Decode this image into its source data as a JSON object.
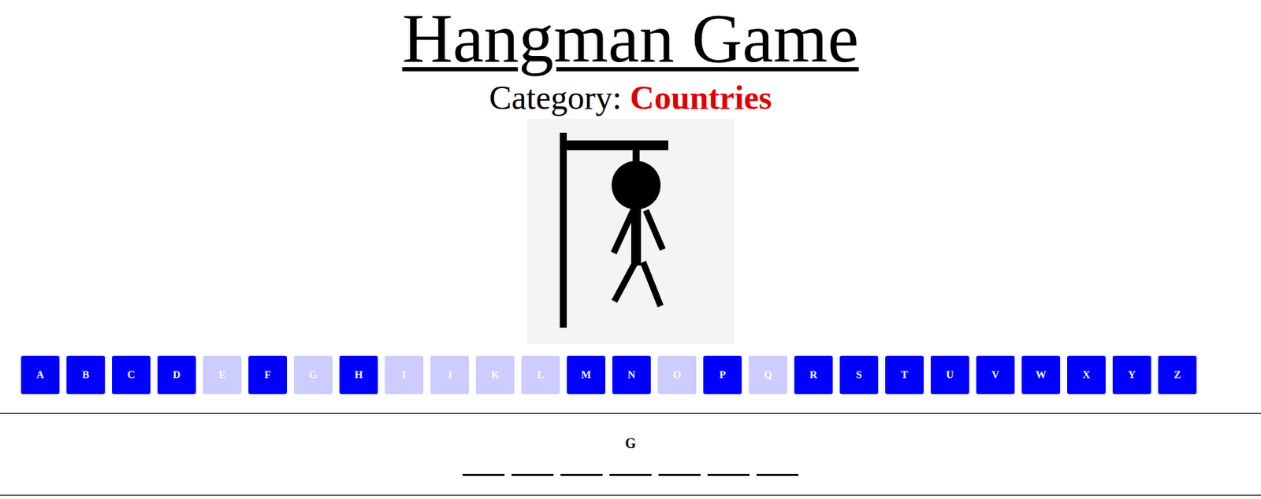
{
  "title": "Hangman Game",
  "category": {
    "label": "Category: ",
    "value": "Countries"
  },
  "letters": [
    {
      "letter": "A",
      "disabled": false
    },
    {
      "letter": "B",
      "disabled": false
    },
    {
      "letter": "C",
      "disabled": false
    },
    {
      "letter": "D",
      "disabled": false
    },
    {
      "letter": "E",
      "disabled": true
    },
    {
      "letter": "F",
      "disabled": false
    },
    {
      "letter": "G",
      "disabled": true
    },
    {
      "letter": "H",
      "disabled": false
    },
    {
      "letter": "I",
      "disabled": true
    },
    {
      "letter": "J",
      "disabled": true
    },
    {
      "letter": "K",
      "disabled": true
    },
    {
      "letter": "L",
      "disabled": true
    },
    {
      "letter": "M",
      "disabled": false
    },
    {
      "letter": "N",
      "disabled": false
    },
    {
      "letter": "O",
      "disabled": true
    },
    {
      "letter": "P",
      "disabled": false
    },
    {
      "letter": "Q",
      "disabled": true
    },
    {
      "letter": "R",
      "disabled": false
    },
    {
      "letter": "S",
      "disabled": false
    },
    {
      "letter": "T",
      "disabled": false
    },
    {
      "letter": "U",
      "disabled": false
    },
    {
      "letter": "V",
      "disabled": false
    },
    {
      "letter": "W",
      "disabled": false
    },
    {
      "letter": "X",
      "disabled": false
    },
    {
      "letter": "Y",
      "disabled": false
    },
    {
      "letter": "Z",
      "disabled": false
    }
  ],
  "word": {
    "shown": "G",
    "slots": [
      {
        "letter": ""
      },
      {
        "letter": ""
      },
      {
        "letter": ""
      },
      {
        "letter": ""
      },
      {
        "letter": ""
      },
      {
        "letter": ""
      },
      {
        "letter": ""
      }
    ]
  }
}
